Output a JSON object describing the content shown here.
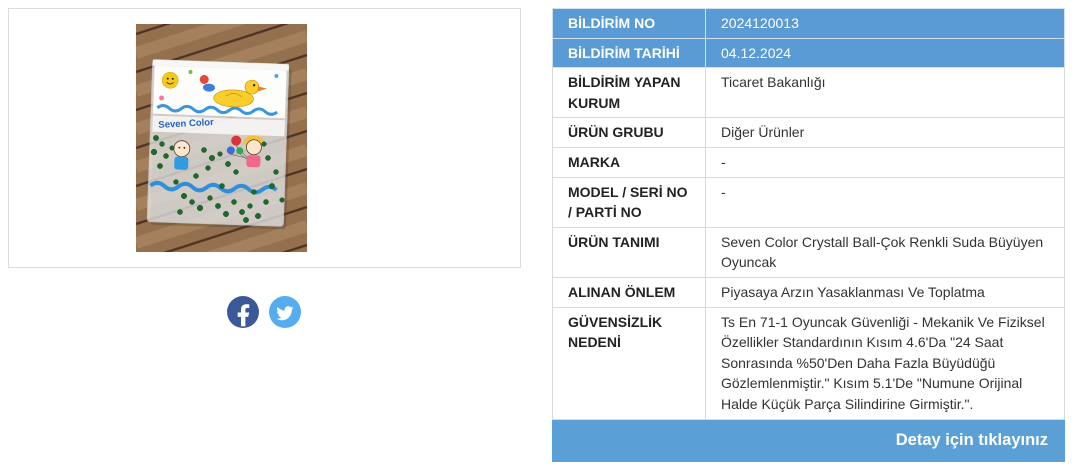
{
  "product_photo": {
    "bag_label": "Seven Color"
  },
  "share": {
    "facebook": {
      "icon": "facebook-icon",
      "color": "#3b5998"
    },
    "twitter": {
      "icon": "twitter-icon",
      "color": "#55acee"
    }
  },
  "details": {
    "rows": [
      {
        "label": "BİLDİRİM NO",
        "value": "2024120013"
      },
      {
        "label": "BİLDİRİM TARİHİ",
        "value": "04.12.2024"
      },
      {
        "label": "BİLDİRİM YAPAN KURUM",
        "value": "Ticaret Bakanlığı"
      },
      {
        "label": "ÜRÜN GRUBU",
        "value": "Diğer Ürünler"
      },
      {
        "label": "MARKA",
        "value": "-"
      },
      {
        "label": "MODEL / SERİ NO / PARTİ NO",
        "value": "-"
      },
      {
        "label": "ÜRÜN TANIMI",
        "value": "Seven Color Crystall Ball-Çok Renkli Suda Büyüyen Oyuncak"
      },
      {
        "label": "ALINAN ÖNLEM",
        "value": "Piyasaya Arzın Yasaklanması Ve Toplatma"
      },
      {
        "label": "GÜVENSİZLİK NEDENİ",
        "value": "Ts En 71-1 Oyuncak Güvenliği - Mekanik Ve Fiziksel Özellikler Standardının Kısım 4.6'Da \"24 Saat Sonrasında %50'Den Daha Fazla Büyüdüğü Gözlemlenmiştir.\" Kısım 5.1'De \"Numune Orijinal Halde Küçük Parça Silindirine Girmiştir.\"."
      }
    ]
  },
  "footer": {
    "detail_link": "Detay için tıklayınız"
  },
  "theme": {
    "accent": "#5b9bd5",
    "footer": "#5aa0d7",
    "label_text": "#222222",
    "value_text": "#333333"
  }
}
